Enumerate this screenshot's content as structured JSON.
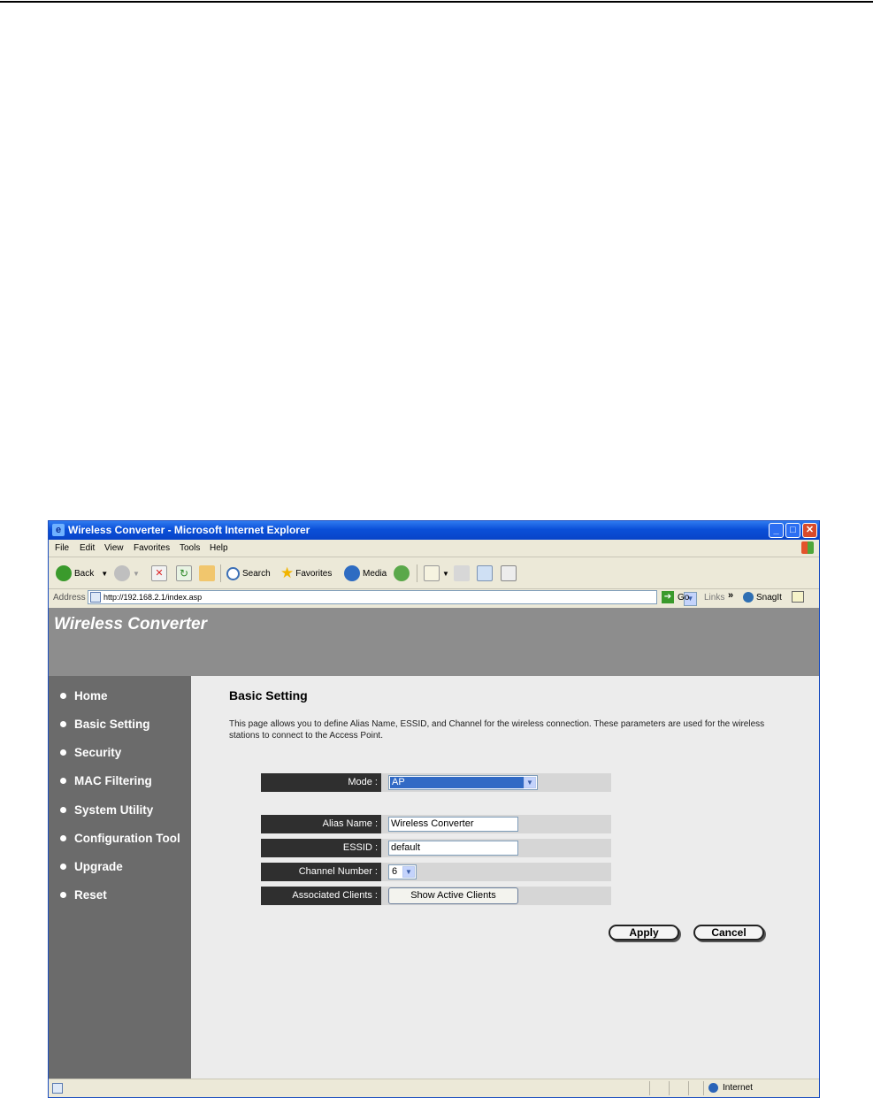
{
  "window": {
    "title": "Wireless Converter - Microsoft Internet Explorer"
  },
  "menu": [
    "File",
    "Edit",
    "View",
    "Favorites",
    "Tools",
    "Help"
  ],
  "toolbar": {
    "back": "Back",
    "search": "Search",
    "favorites": "Favorites",
    "media": "Media"
  },
  "address": {
    "label": "Address",
    "url": "http://192.168.2.1/index.asp",
    "go": "Go",
    "links": "Links",
    "snagit": "SnagIt"
  },
  "header": {
    "brand": "Wireless Converter"
  },
  "sidebar": {
    "items": [
      {
        "label": "Home"
      },
      {
        "label": "Basic Setting"
      },
      {
        "label": "Security"
      },
      {
        "label": "MAC Filtering"
      },
      {
        "label": "System Utility"
      },
      {
        "label": "Configuration Tool"
      },
      {
        "label": "Upgrade"
      },
      {
        "label": "Reset"
      }
    ]
  },
  "main": {
    "heading": "Basic Setting",
    "description": "This page allows you to define Alias Name, ESSID, and Channel for the wireless connection. These parameters are used for the wireless stations to connect to the Access Point.",
    "form": {
      "mode_label": "Mode :",
      "mode_value": "AP",
      "alias_label": "Alias Name :",
      "alias_value": "Wireless Converter",
      "essid_label": "ESSID :",
      "essid_value": "default",
      "channel_label": "Channel Number :",
      "channel_value": "6",
      "clients_label": "Associated Clients :",
      "clients_button": "Show Active Clients"
    },
    "apply": "Apply",
    "cancel": "Cancel"
  },
  "status": {
    "zone": "Internet"
  }
}
